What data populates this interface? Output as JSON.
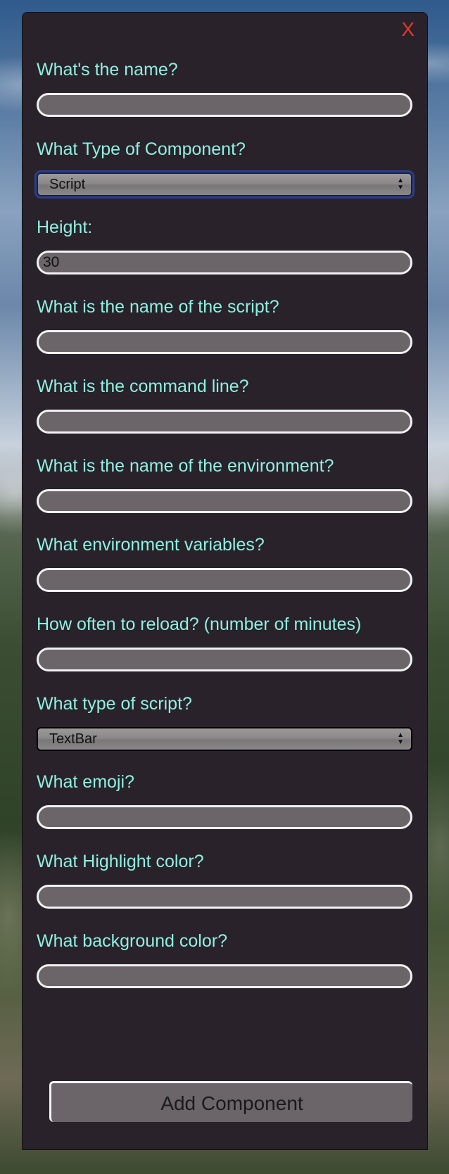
{
  "form": {
    "close_label": "X",
    "fields": [
      {
        "label": "What's the name?",
        "value": ""
      },
      {
        "label": "What Type of Component?",
        "value": "Script"
      },
      {
        "label": "Height:",
        "value": "30"
      },
      {
        "label": "What is the name of the script?",
        "value": ""
      },
      {
        "label": "What is the command line?",
        "value": ""
      },
      {
        "label": "What is the name of the environment?",
        "value": ""
      },
      {
        "label": "What environment variables?",
        "value": ""
      },
      {
        "label": "How often to reload? (number of minutes)",
        "value": ""
      },
      {
        "label": "What type of script?",
        "value": "TextBar"
      },
      {
        "label": "What emoji?",
        "value": ""
      },
      {
        "label": "What Highlight color?",
        "value": ""
      },
      {
        "label": "What background color?",
        "value": ""
      }
    ],
    "submit_label": "Add Component",
    "select_arrows": "▲\n▼"
  },
  "colors": {
    "panel_bg": "#29222b",
    "label": "#8ff0e0",
    "close": "#e2392a",
    "input_bg": "#6b6569",
    "focus_ring": "#2b3f8c"
  },
  "icons": {
    "close": "close-icon",
    "select_arrows": "select-arrows-icon"
  }
}
